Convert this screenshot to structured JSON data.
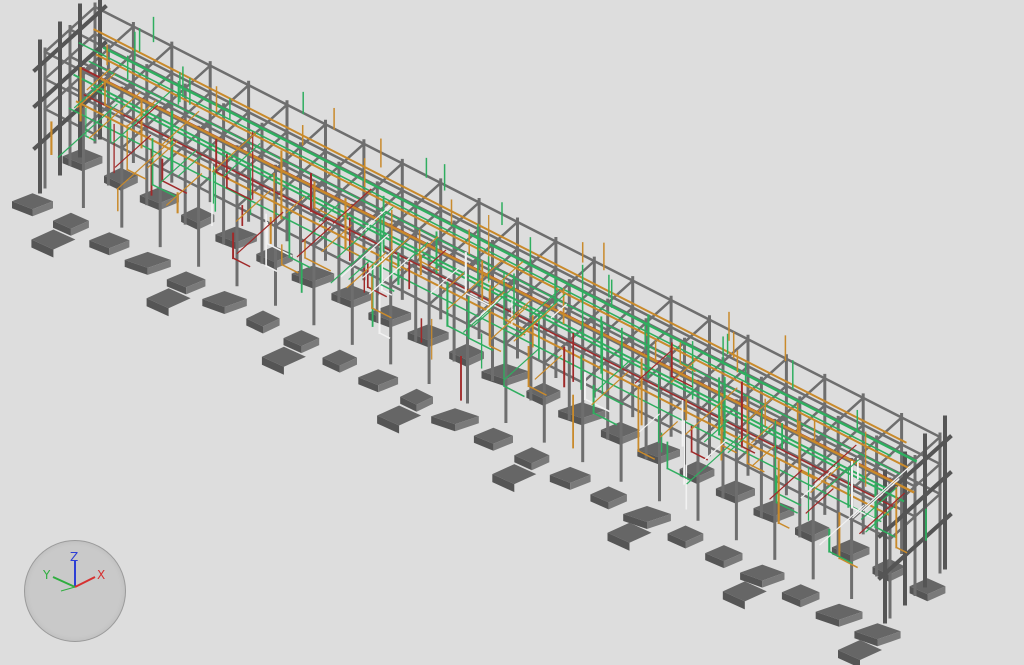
{
  "viewport": {
    "background": "#dddddd",
    "colors": {
      "structure": "#6e6e6e",
      "structure_dark": "#555555",
      "foundation": "#666666",
      "pipe_green": "#2fae5f",
      "pipe_orange": "#c98a2b",
      "pipe_red": "#a02a2a",
      "pipe_white": "#f2f2f2"
    }
  },
  "orientation_widget": {
    "z_label": "Z",
    "y_label": "Y",
    "x_label": "X",
    "z_color": "#2d3fd6",
    "y_color": "#2fae3f",
    "x_color": "#d63030"
  }
}
